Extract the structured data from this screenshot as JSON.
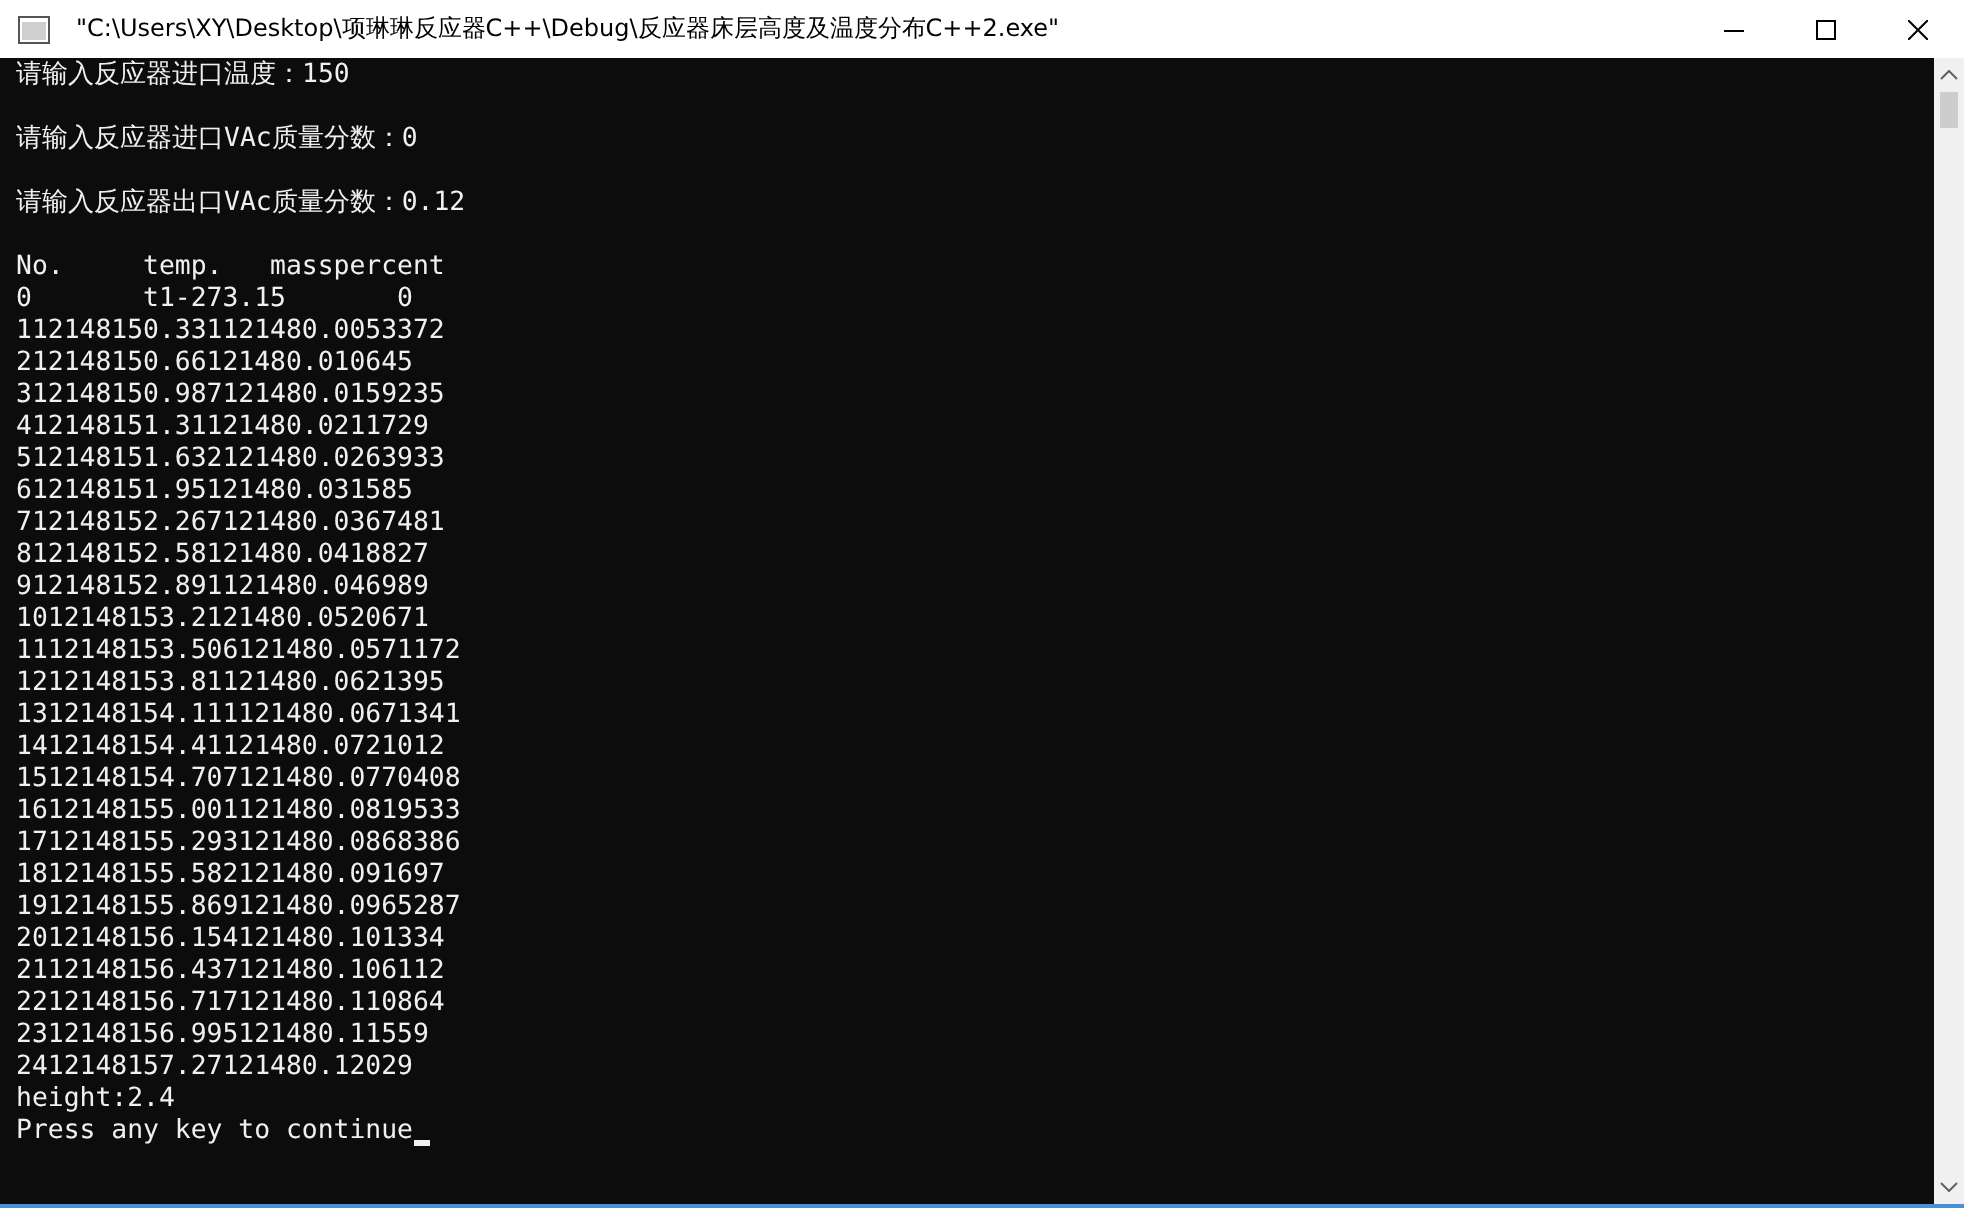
{
  "window": {
    "title": "\"C:\\Users\\XY\\Desktop\\项琳琳反应器C++\\Debug\\反应器床层高度及温度分布C++2.exe\""
  },
  "console": {
    "prompts": [
      "请输入反应器进口温度：150",
      "请输入反应器进口VAc质量分数：0",
      "请输入反应器出口VAc质量分数：0.12"
    ],
    "table_header": "No.     temp.   masspercent",
    "rows": [
      "0       t1-273.15       0",
      "112148150.331121480.0053372",
      "212148150.66121480.010645",
      "312148150.987121480.0159235",
      "412148151.31121480.0211729",
      "512148151.632121480.0263933",
      "612148151.95121480.031585",
      "712148152.267121480.0367481",
      "812148152.58121480.0418827",
      "912148152.891121480.046989",
      "1012148153.2121480.0520671",
      "1112148153.506121480.0571172",
      "1212148153.81121480.0621395",
      "1312148154.111121480.0671341",
      "1412148154.41121480.0721012",
      "1512148154.707121480.0770408",
      "1612148155.001121480.0819533",
      "1712148155.293121480.0868386",
      "1812148155.582121480.091697",
      "1912148155.869121480.0965287",
      "2012148156.154121480.101334",
      "2112148156.437121480.106112",
      "2212148156.717121480.110864",
      "2312148156.995121480.11559",
      "2412148157.27121480.12029"
    ],
    "result": "height:2.4",
    "pause": "Press any key to continue"
  }
}
